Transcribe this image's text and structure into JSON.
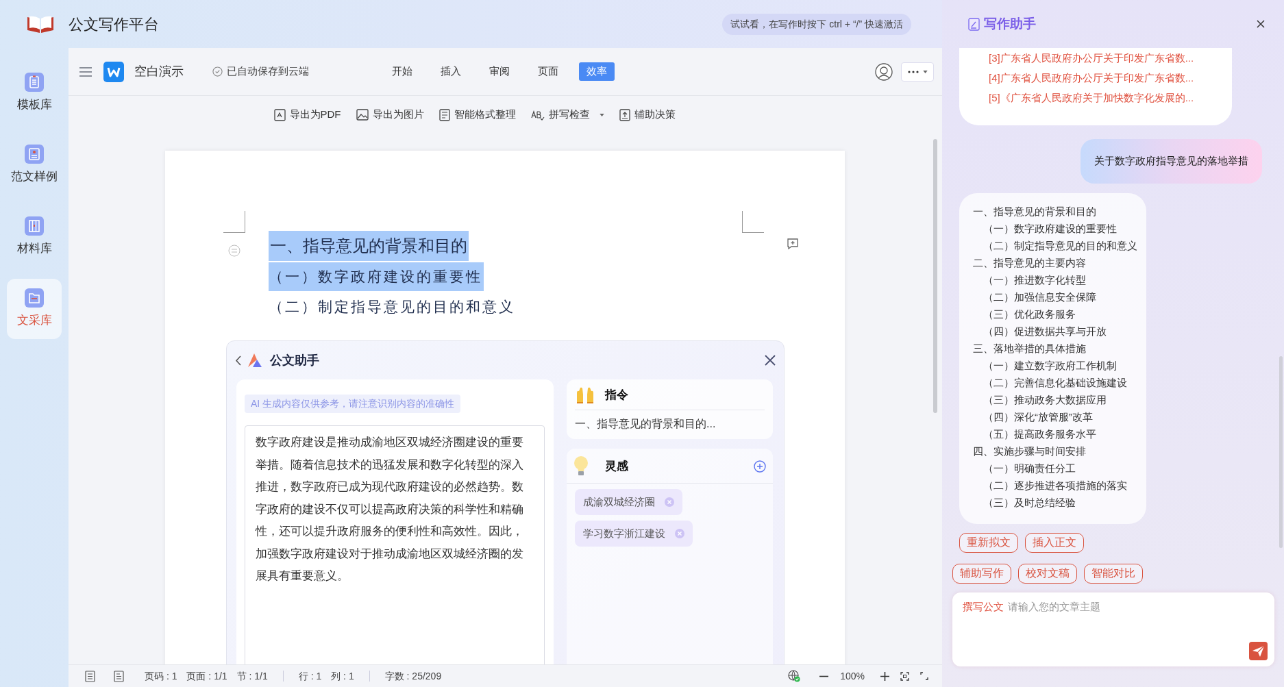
{
  "app": {
    "title": "公文写作平台"
  },
  "hint": "试试看，在写作时按下 ctrl + “/” 快速激活",
  "sidebar": {
    "items": [
      {
        "label": "模板库",
        "selected": false
      },
      {
        "label": "范文样例",
        "selected": false
      },
      {
        "label": "材料库",
        "selected": false
      },
      {
        "label": "文采库",
        "selected": true
      }
    ]
  },
  "editor": {
    "doc_name": "空白演示",
    "save_status": "已自动保存到云端",
    "tabs": [
      {
        "label": "开始",
        "selected": false
      },
      {
        "label": "插入",
        "selected": false
      },
      {
        "label": "审阅",
        "selected": false
      },
      {
        "label": "页面",
        "selected": false
      },
      {
        "label": "效率",
        "selected": true
      }
    ],
    "toolbar": [
      {
        "label": "导出为PDF",
        "dropdown": false
      },
      {
        "label": "导出为图片",
        "dropdown": false
      },
      {
        "label": "智能格式整理",
        "dropdown": false
      },
      {
        "label": "拼写检查",
        "dropdown": true
      },
      {
        "label": "辅助决策",
        "dropdown": false
      }
    ]
  },
  "document": {
    "headings": [
      {
        "kind": "title",
        "text": "一、指导意见的背景和目的",
        "selected": true
      },
      {
        "kind": "subtitle",
        "text": "（一）数字政府建设的重要性",
        "selected": true
      },
      {
        "kind": "subtitle",
        "text": "（二）制定指导意见的目的和意义",
        "selected": false
      }
    ]
  },
  "assistant": {
    "title": "公文助手",
    "notice": "AI 生成内容仅供参考，请注意识别内容的准确性",
    "generated_text": "数字政府建设是推动成渝地区双城经济圈建设的重要举措。随着信息技术的迅猛发展和数字化转型的深入推进，数字政府已成为现代政府建设的必然趋势。数字政府的建设不仅可以提高政府决策的科学性和精确性，还可以提升政府服务的便利性和高效性。因此，加强数字政府建设对于推动成渝地区双城经济圈的发展具有重要意义。",
    "command": {
      "title": "指令",
      "text": "一、指导意见的背景和目的..."
    },
    "inspiration": {
      "title": "灵感",
      "tags": [
        "成渝双城经济圈",
        "学习数字浙江建设"
      ]
    }
  },
  "status_bar": {
    "groups": [
      [
        "页码 : 1",
        "页面 : 1/1",
        "节 : 1/1"
      ],
      [
        "行 : 1",
        "列 : 1"
      ],
      [
        "字数 : 25/209"
      ]
    ],
    "zoom": "100%"
  },
  "writing_assistant": {
    "title": "写作助手",
    "references": [
      "[3]广东省人民政府办公厅关于印发广东省数...",
      "[4]广东省人民政府办公厅关于印发广东省数...",
      "[5]《广东省人民政府关于加快数字化发展的..."
    ],
    "user_message": "关于数字政府指导意见的落地举措",
    "outline": [
      {
        "text": "一、指导意见的背景和目的",
        "children": [
          {
            "text": "（一）数字政府建设的重要性"
          },
          {
            "text": "（二）制定指导意见的目的和意义"
          }
        ]
      },
      {
        "text": "二、指导意见的主要内容",
        "children": [
          {
            "text": "（一）推进数字化转型"
          },
          {
            "text": "（二）加强信息安全保障"
          },
          {
            "text": "（三）优化政务服务"
          },
          {
            "text": "（四）促进数据共享与开放"
          }
        ]
      },
      {
        "text": "三、落地举措的具体措施",
        "children": [
          {
            "text": "（一）建立数字政府工作机制"
          },
          {
            "text": "（二）完善信息化基础设施建设"
          },
          {
            "text": "（三）推动政务大数据应用"
          },
          {
            "text": "（四）深化“放管服”改革"
          },
          {
            "text": "（五）提高政务服务水平"
          }
        ]
      },
      {
        "text": "四、实施步骤与时间安排",
        "children": [
          {
            "text": "（一）明确责任分工"
          },
          {
            "text": "（二）逐步推进各项措施的落实"
          },
          {
            "text": "（三）及时总结经验"
          }
        ]
      }
    ],
    "actions": [
      [
        "重新拟文",
        "插入正文"
      ],
      [
        "辅助写作",
        "校对文稿",
        "智能对比"
      ]
    ],
    "input": {
      "mode": "撰写公文",
      "placeholder": "请输入您的文章主题"
    }
  }
}
